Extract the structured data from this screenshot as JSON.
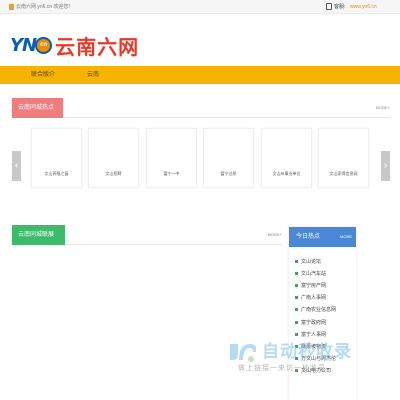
{
  "topbar": {
    "welcome": "云南六网 yn6.cn 欢迎您!",
    "tel_label": "客服:",
    "tel_value": "www.yn6.cn"
  },
  "logo": {
    "yn": "YN",
    "badge": "cn",
    "name": "云南六网"
  },
  "nav": {
    "items": [
      "联合版介",
      "云南"
    ]
  },
  "hot_section": {
    "title": "云南同城热点",
    "subtitle": "hot",
    "more": "MORE+",
    "cards": [
      "文山养殖之窗",
      "文山招聘",
      "富宁一中",
      "富宁过桥",
      "文山州事业单位",
      "文山家得信息网"
    ]
  },
  "links_section": {
    "title": "云南同城联展",
    "subtitle": "City",
    "more": "MORE+"
  },
  "hot_panel": {
    "title": "今日热点",
    "more": "MORE",
    "items": [
      "文山论坛",
      "文山汽车站",
      "富宁房产网",
      "广南人事网",
      "广南农业信息网",
      "富宁政府网",
      "富宁人事网",
      "麻栗坡物流",
      "方文山与周杰伦",
      "文山电力公司"
    ]
  },
  "watermark": {
    "title": "自动秒收录",
    "subtitle": "做上链接一来访一秒收录"
  },
  "colors": {
    "topbar": "#f6f6f6",
    "nav": "#f6b400",
    "hot_tab": "#f07d7d",
    "links_tab": "#3dba6b",
    "panel_head": "#4a88d6",
    "bullet": "#29b34b"
  }
}
